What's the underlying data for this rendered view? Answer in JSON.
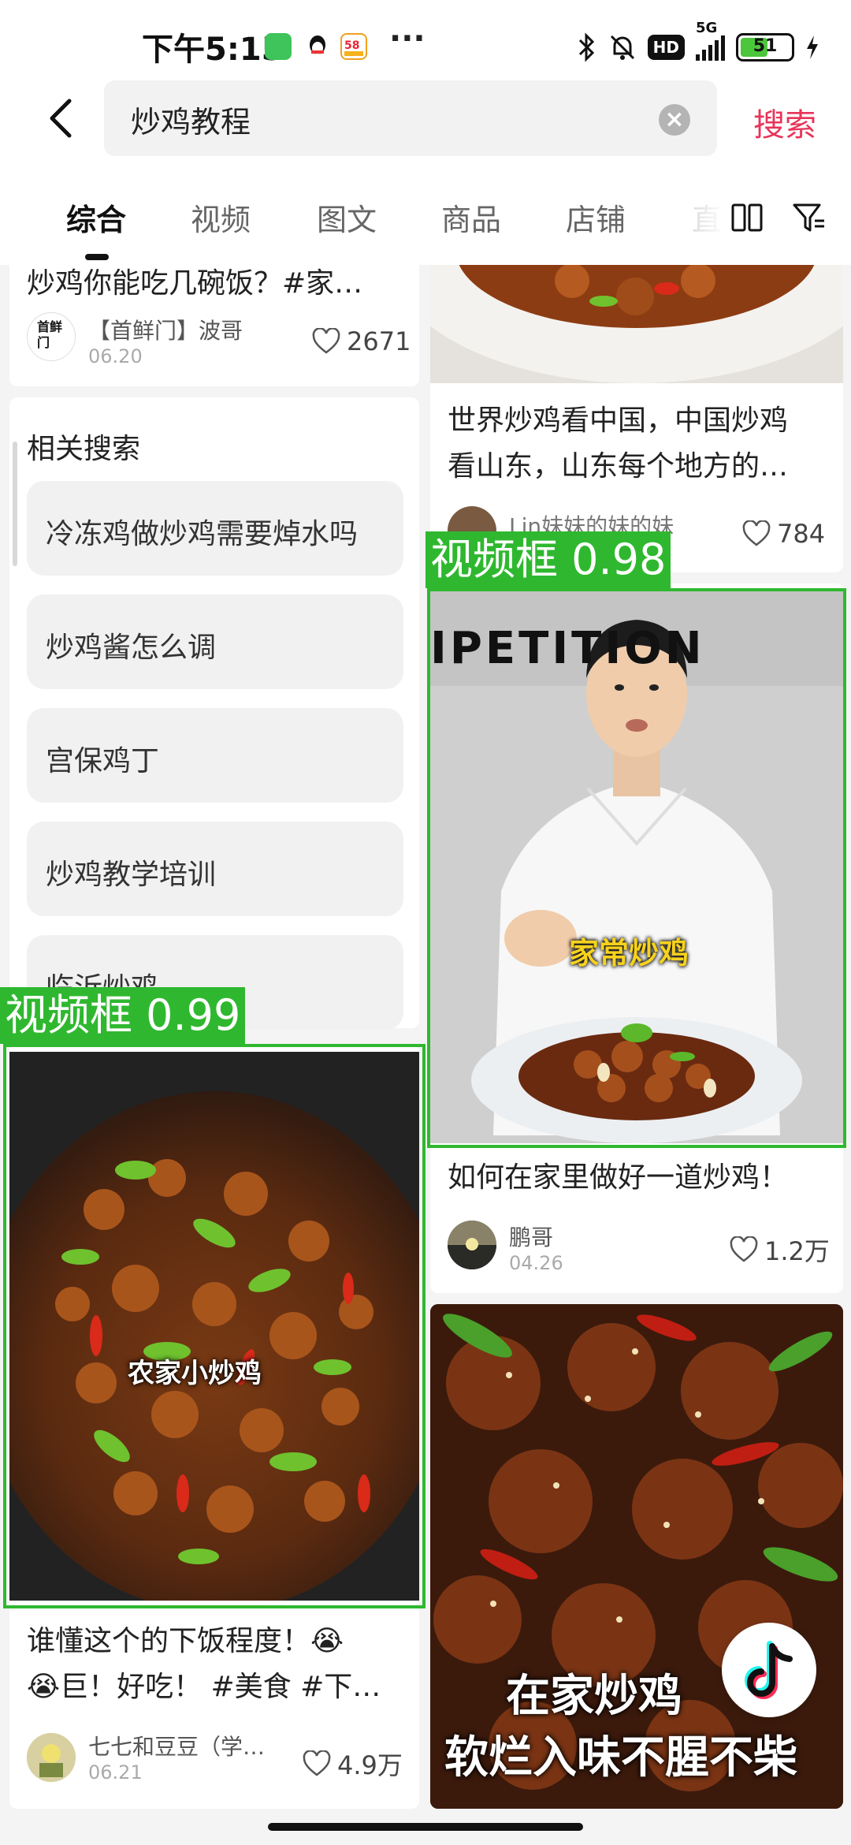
{
  "status_bar": {
    "time": "下午5:15",
    "dots": "···",
    "hd_badge": "HD",
    "network": "5G",
    "battery": "51"
  },
  "search": {
    "query": "炒鸡教程",
    "clear_label": "×",
    "submit_label": "搜索"
  },
  "tabs": [
    {
      "label": "综合",
      "active": true
    },
    {
      "label": "视频",
      "active": false
    },
    {
      "label": "图文",
      "active": false
    },
    {
      "label": "商品",
      "active": false
    },
    {
      "label": "店铺",
      "active": false
    },
    {
      "label": "直",
      "active": false
    }
  ],
  "feed_left": {
    "top_card": {
      "title": "炒鸡你能吃几碗饭？#家…",
      "avatar_text": "首鲜门",
      "author": "【首鲜门】波哥",
      "date": "06.20",
      "likes": "2671"
    },
    "related": {
      "title": "相关搜索",
      "items": [
        "冷冻鸡做炒鸡需要焯水吗",
        "炒鸡酱怎么调",
        "宫保鸡丁",
        "炒鸡教学培训",
        "临沂炒鸡"
      ]
    },
    "video_card": {
      "detection_label": "视频框 0.99",
      "overlay_text": "农家小炒鸡",
      "title_line1": "谁懂这个的下饭程度！😭",
      "title_line2": "😭巨！好吃！ #美食 #下…",
      "author": "七七和豆豆（学…",
      "date": "06.21",
      "likes": "4.9万"
    }
  },
  "feed_right": {
    "top_card": {
      "title_line1": "世界炒鸡看中国，中国炒鸡",
      "title_line2": "看山东，山东每个地方的…",
      "author": "Lin妹妹的妹的妹",
      "likes": "784"
    },
    "video_card": {
      "detection_label": "视频框 0.98",
      "wall_text": "IPETITION",
      "overlay_text": "家常炒鸡",
      "title": "如何在家里做好一道炒鸡！",
      "author": "鹏哥",
      "date": "04.26",
      "likes": "1.2万"
    },
    "bottom_card": {
      "overlay_line1": "在家炒鸡",
      "overlay_line2": "软烂入味不腥不柴"
    }
  },
  "colors": {
    "accent": "#e8345a",
    "detection": "#2fb82f",
    "battery": "#4cc63a"
  }
}
